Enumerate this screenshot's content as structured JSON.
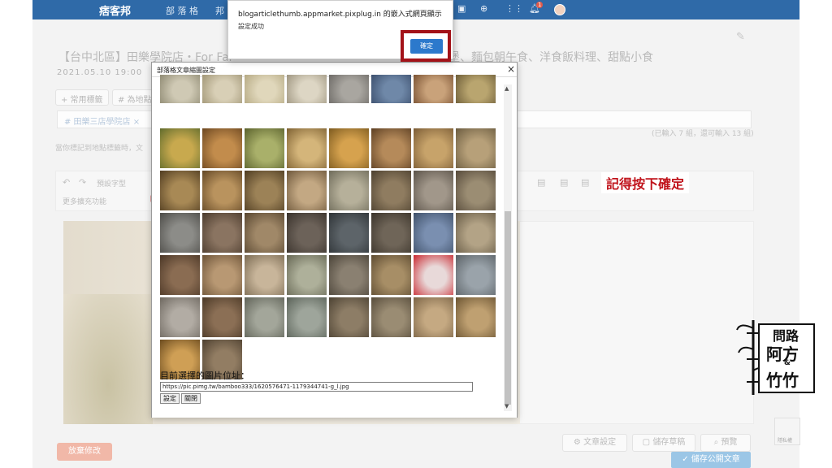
{
  "topbar": {
    "logo": "痞客邦",
    "nav_items": [
      "部 落 格",
      "邦"
    ]
  },
  "notifications": {
    "badge": "1"
  },
  "post": {
    "title_left": "【台中北區】田樂學院店・For Far",
    "title_right": "堡、麵包朝午食、洋食飯料理、甜點小食",
    "date": "2021.05.10 19:00"
  },
  "tags": {
    "common_button": "+ 常用標籤",
    "location_button": "# 為地點",
    "chip": "# 田樂三店學院店 ×",
    "count": "(已輸入 7 組，還可輸入 13 組)",
    "hint": "當你標記到地點標籤時，文"
  },
  "toolbar": {
    "format_select": "預設字型",
    "more": "更多擴充功能"
  },
  "annotation": {
    "text": "記得按下確定"
  },
  "dialog": {
    "title": "部落格文章縮圖設定",
    "close": "×",
    "url_label": "目前選擇的圖片位址：",
    "url_value": "https://pic.pimg.tw/bamboo333/1620576471-1179344741-g_l.jpg",
    "set_button": "設定",
    "close_button": "關閉",
    "thumbnails": [
      {
        "c1": "#cfc9b4",
        "c2": "#8f8a73"
      },
      {
        "c1": "#d8cfb6",
        "c2": "#a19676"
      },
      {
        "c1": "#e0d7bb",
        "c2": "#b5a983"
      },
      {
        "c1": "#ddd6c4",
        "c2": "#9e9580"
      },
      {
        "c1": "#a9a6a0",
        "c2": "#6d6a66"
      },
      {
        "c1": "#6f88a8",
        "c2": "#3c4f6d"
      },
      {
        "c1": "#c9a27a",
        "c2": "#7a5233"
      },
      {
        "c1": "#b9a56f",
        "c2": "#6d5d38"
      },
      {
        "c1": "#c8a94e",
        "c2": "#5f6b2c"
      },
      {
        "c1": "#c28c4c",
        "c2": "#6b4620"
      },
      {
        "c1": "#a9b06a",
        "c2": "#59602b"
      },
      {
        "c1": "#d4b57a",
        "c2": "#7d6031"
      },
      {
        "c1": "#d6a24e",
        "c2": "#7c5a1f"
      },
      {
        "c1": "#b58a5a",
        "c2": "#5b3e22"
      },
      {
        "c1": "#c7a36a",
        "c2": "#7a5b35"
      },
      {
        "c1": "#b7a079",
        "c2": "#6a5b3f"
      },
      {
        "c1": "#a88955",
        "c2": "#4f3b20"
      },
      {
        "c1": "#b9935e",
        "c2": "#614625"
      },
      {
        "c1": "#9c8257",
        "c2": "#4d3b21"
      },
      {
        "c1": "#c3a883",
        "c2": "#6c563a"
      },
      {
        "c1": "#b6b09a",
        "c2": "#6d6a59"
      },
      {
        "c1": "#8f7c60",
        "c2": "#4b3f2e"
      },
      {
        "c1": "#a1978a",
        "c2": "#5a5248"
      },
      {
        "c1": "#9b8d73",
        "c2": "#55493a"
      },
      {
        "c1": "#8c8c88",
        "c2": "#4c4b47"
      },
      {
        "c1": "#8a7461",
        "c2": "#4a3a2c"
      },
      {
        "c1": "#a08868",
        "c2": "#57452f"
      },
      {
        "c1": "#6c6259",
        "c2": "#38312b"
      },
      {
        "c1": "#5d6469",
        "c2": "#2e3336"
      },
      {
        "c1": "#6f6558",
        "c2": "#3a332a"
      },
      {
        "c1": "#7a8fb0",
        "c2": "#3e4f68"
      },
      {
        "c1": "#b3a386",
        "c2": "#665a45"
      },
      {
        "c1": "#8a6c52",
        "c2": "#4a3626"
      },
      {
        "c1": "#b89873",
        "c2": "#6b5237"
      },
      {
        "c1": "#c8b59a",
        "c2": "#7a6a52"
      },
      {
        "c1": "#aeb09a",
        "c2": "#656653"
      },
      {
        "c1": "#8a8071",
        "c2": "#4a4338"
      },
      {
        "c1": "#a78e66",
        "c2": "#5c4a30"
      },
      {
        "c1": "#e8d9d9",
        "c2": "#c9262e"
      },
      {
        "c1": "#9aa3aa",
        "c2": "#5a6166"
      },
      {
        "c1": "#b2aca4",
        "c2": "#6d675f"
      },
      {
        "c1": "#8b6f55",
        "c2": "#4a3826"
      },
      {
        "c1": "#a3a69a",
        "c2": "#5e6156"
      },
      {
        "c1": "#9ea59b",
        "c2": "#596157"
      },
      {
        "c1": "#8d7d66",
        "c2": "#4b4132"
      },
      {
        "c1": "#9a8c73",
        "c2": "#564b3a"
      },
      {
        "c1": "#c5a982",
        "c2": "#7a6345"
      },
      {
        "c1": "#bfa071",
        "c2": "#6a5331"
      },
      {
        "c1": "#cf9f55",
        "c2": "#6a4a1e"
      },
      {
        "c1": "#927d63",
        "c2": "#4c3f2f"
      }
    ]
  },
  "alert": {
    "message": "blogarticlethumb.appmarket.pixplug.in 的嵌入式網頁顯示",
    "sub": "設定成功",
    "ok": "確定"
  },
  "bottom": {
    "discard": "放棄修改",
    "settings": "文章設定",
    "draft": "儲存草稿",
    "preview": "預覽",
    "publish": "儲存公開文章"
  },
  "watermark": {
    "line1": "問路",
    "line2": "阿方",
    "line3": "竹竹",
    "amp": "&"
  },
  "recaptcha": {
    "label": "隱私權"
  }
}
